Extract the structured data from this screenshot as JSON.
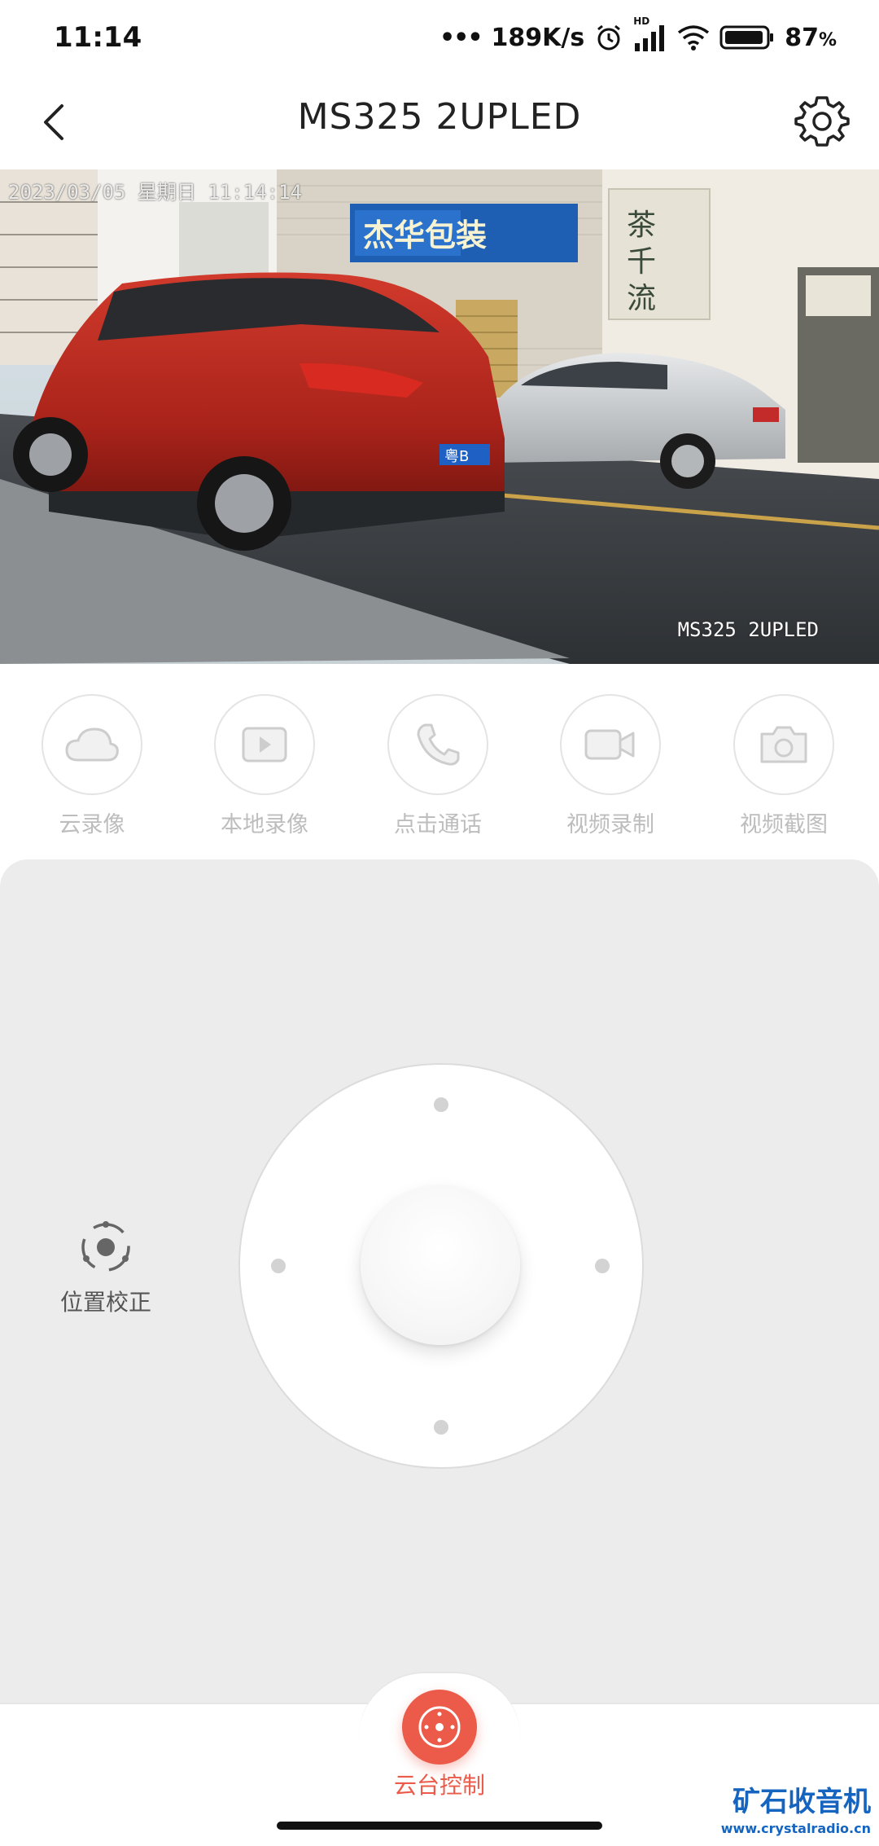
{
  "status_bar": {
    "time": "11:14",
    "network_speed": "189K/s",
    "battery": "87",
    "battery_unit": "%",
    "signal_badge": "HD"
  },
  "header": {
    "title": "MS325 2UPLED"
  },
  "video": {
    "timestamp": "2023/03/05 星期日 11:14:14",
    "camera_name": "MS325 2UPLED"
  },
  "actions": [
    {
      "label": "云录像",
      "icon": "cloud-icon"
    },
    {
      "label": "本地录像",
      "icon": "play-video-icon"
    },
    {
      "label": "点击通话",
      "icon": "phone-icon"
    },
    {
      "label": "视频录制",
      "icon": "video-camera-icon"
    },
    {
      "label": "视频截图",
      "icon": "camera-icon"
    }
  ],
  "ptz": {
    "calibrate_label": "位置校正"
  },
  "bottom_nav": {
    "ptz_label": "云台控制"
  },
  "watermark": {
    "name": "矿石收音机",
    "url": "www.crystalradio.cn"
  },
  "colors": {
    "accent": "#ec5b4a",
    "panel_bg": "#ececec",
    "disabled_text": "#bdbdbd"
  }
}
